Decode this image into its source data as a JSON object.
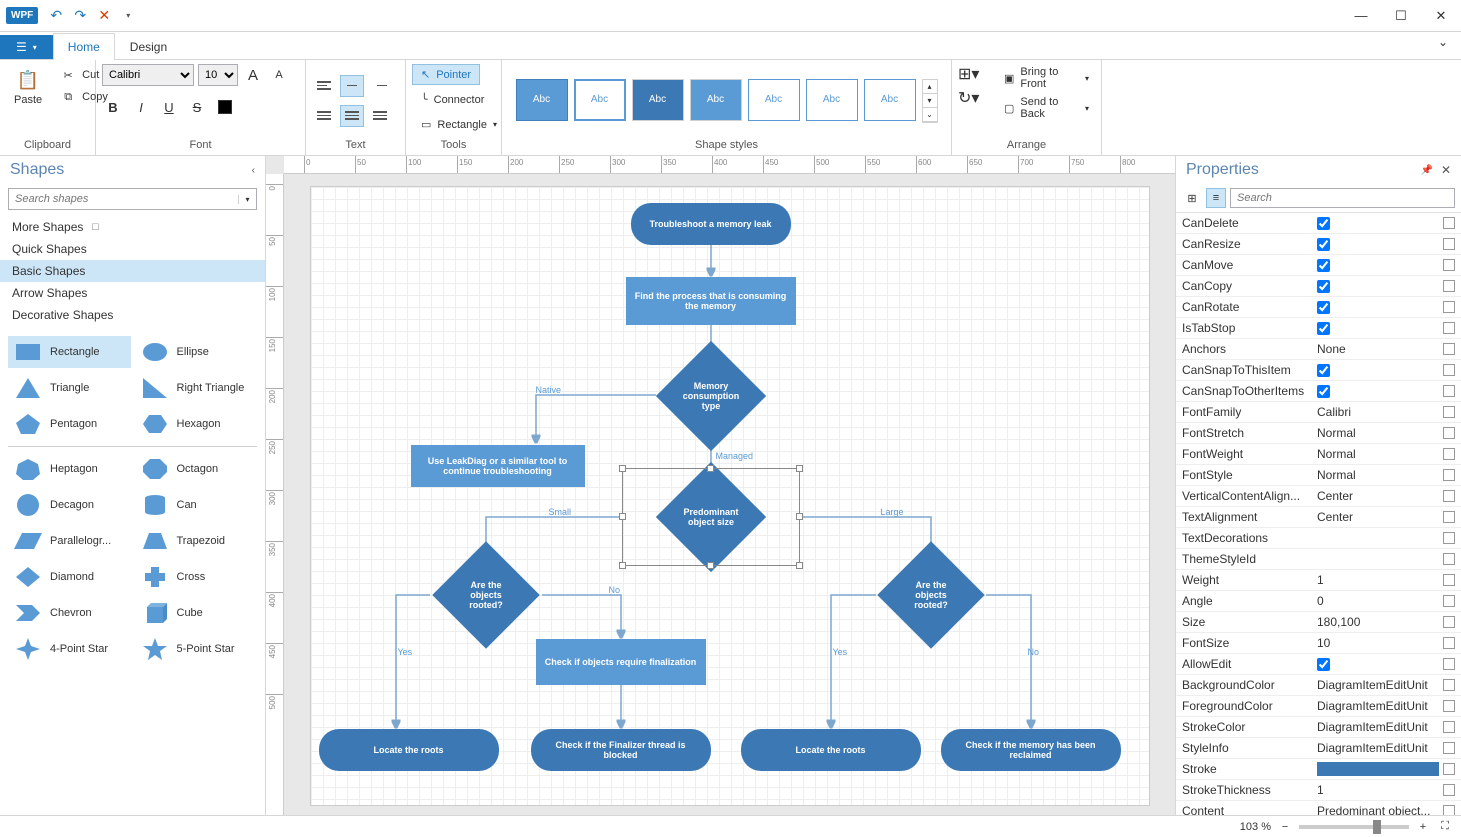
{
  "qat": {
    "undo": "↶",
    "redo": "↷",
    "close_x": "✕",
    "dd": "▾"
  },
  "window": {
    "min": "—",
    "max": "☐",
    "close": "✕"
  },
  "tabs": {
    "file_icon": "☰",
    "file_dd": "▾",
    "home": "Home",
    "design": "Design",
    "help": "⌄"
  },
  "ribbon": {
    "clipboard": {
      "paste": "Paste",
      "cut": "Cut",
      "copy": "Copy",
      "label": "Clipboard"
    },
    "font": {
      "family": "Calibri",
      "size": "10",
      "grow": "A",
      "shrink": "A",
      "bold": "B",
      "italic": "I",
      "underline": "U",
      "strike": "S",
      "label": "Font"
    },
    "text_group": {
      "label": "Text"
    },
    "tools": {
      "pointer": "Pointer",
      "connector": "Connector",
      "rectangle": "Rectangle",
      "label": "Tools"
    },
    "styles": {
      "items": [
        "Abc",
        "Abc",
        "Abc",
        "Abc",
        "Abc",
        "Abc",
        "Abc"
      ],
      "label": "Shape styles"
    },
    "arrange": {
      "front": "Bring to Front",
      "back": "Send to Back",
      "label": "Arrange"
    }
  },
  "shapes_panel": {
    "title": "Shapes",
    "search_placeholder": "Search shapes",
    "cats": [
      "More Shapes",
      "Quick Shapes",
      "Basic Shapes",
      "Arrow Shapes",
      "Decorative Shapes"
    ],
    "grid": [
      [
        "Rectangle",
        "Ellipse"
      ],
      [
        "Triangle",
        "Right Triangle"
      ],
      [
        "Pentagon",
        "Hexagon"
      ],
      [
        "Heptagon",
        "Octagon"
      ],
      [
        "Decagon",
        "Can"
      ],
      [
        "Parallelogr...",
        "Trapezoid"
      ],
      [
        "Diamond",
        "Cross"
      ],
      [
        "Chevron",
        "Cube"
      ],
      [
        "4-Point Star",
        "5-Point Star"
      ]
    ]
  },
  "ruler": {
    "h": [
      "0",
      "50",
      "100",
      "150",
      "200",
      "250",
      "300",
      "350",
      "400",
      "450",
      "500",
      "550",
      "600",
      "650",
      "700",
      "750",
      "800"
    ],
    "v": [
      "0",
      "50",
      "100",
      "150",
      "200",
      "250",
      "300",
      "350",
      "400",
      "450",
      "500"
    ]
  },
  "flowchart": {
    "n1": "Troubleshoot a memory leak",
    "n2": "Find the process that is consuming the memory",
    "n3": "Memory consumption type",
    "n4": "Use LeakDiag or a similar tool to continue troubleshooting",
    "n5": "Predominant object size",
    "n6": "Are the objects rooted?",
    "n7": "Are the objects rooted?",
    "n8": "Check if objects require finalization",
    "n9": "Locate the roots",
    "n10": "Check if the Finalizer thread is blocked",
    "n11": "Locate the roots",
    "n12": "Check if the memory has been reclaimed",
    "lbl_native": "Native",
    "lbl_managed": "Managed",
    "lbl_small": "Small",
    "lbl_large": "Large",
    "lbl_yes": "Yes",
    "lbl_no": "No"
  },
  "props": {
    "title": "Properties",
    "search_placeholder": "Search",
    "rows": [
      {
        "name": "CanDelete",
        "type": "check",
        "checked": true
      },
      {
        "name": "CanResize",
        "type": "check",
        "checked": true
      },
      {
        "name": "CanMove",
        "type": "check",
        "checked": true
      },
      {
        "name": "CanCopy",
        "type": "check",
        "checked": true
      },
      {
        "name": "CanRotate",
        "type": "check",
        "checked": true
      },
      {
        "name": "IsTabStop",
        "type": "check",
        "checked": true
      },
      {
        "name": "Anchors",
        "type": "text",
        "value": "None"
      },
      {
        "name": "CanSnapToThisItem",
        "type": "check",
        "checked": true
      },
      {
        "name": "CanSnapToOtherItems",
        "type": "check",
        "checked": true
      },
      {
        "name": "FontFamily",
        "type": "text",
        "value": "Calibri"
      },
      {
        "name": "FontStretch",
        "type": "text",
        "value": "Normal"
      },
      {
        "name": "FontWeight",
        "type": "text",
        "value": "Normal"
      },
      {
        "name": "FontStyle",
        "type": "text",
        "value": "Normal"
      },
      {
        "name": "VerticalContentAlign...",
        "type": "text",
        "value": "Center"
      },
      {
        "name": "TextAlignment",
        "type": "text",
        "value": "Center"
      },
      {
        "name": "TextDecorations",
        "type": "text",
        "value": ""
      },
      {
        "name": "ThemeStyleId",
        "type": "text",
        "value": ""
      },
      {
        "name": "Weight",
        "type": "text",
        "value": "1"
      },
      {
        "name": "Angle",
        "type": "text",
        "value": "0"
      },
      {
        "name": "Size",
        "type": "text",
        "value": "180,100"
      },
      {
        "name": "FontSize",
        "type": "text",
        "value": "10"
      },
      {
        "name": "AllowEdit",
        "type": "check",
        "checked": true
      },
      {
        "name": "BackgroundColor",
        "type": "text",
        "value": "DiagramItemEditUnit"
      },
      {
        "name": "ForegroundColor",
        "type": "text",
        "value": "DiagramItemEditUnit"
      },
      {
        "name": "StrokeColor",
        "type": "text",
        "value": "DiagramItemEditUnit"
      },
      {
        "name": "StyleInfo",
        "type": "text",
        "value": "DiagramItemEditUnit"
      },
      {
        "name": "Stroke",
        "type": "color",
        "value": "#3c79b4"
      },
      {
        "name": "StrokeThickness",
        "type": "text",
        "value": "1"
      },
      {
        "name": "Content",
        "type": "text",
        "value": "Predominant object..."
      }
    ]
  },
  "status": {
    "zoom": "103 %",
    "minus": "−",
    "plus": "+",
    "fit": "⛶"
  }
}
